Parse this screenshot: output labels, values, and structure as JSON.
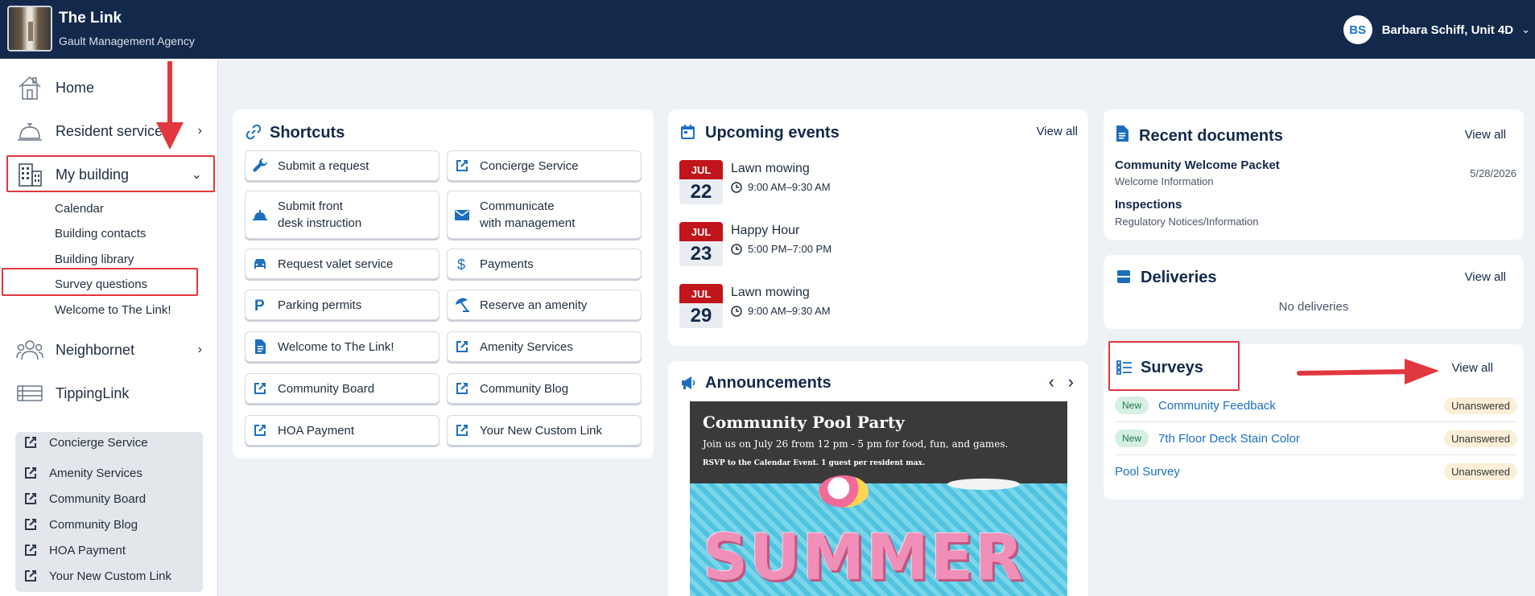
{
  "header": {
    "app_title": "The Link",
    "agency": "Gault Management Agency",
    "user_initials": "BS",
    "user_name": "Barbara Schiff, Unit 4D"
  },
  "sidebar": {
    "items": [
      {
        "label": "Home",
        "icon": "home-icon"
      },
      {
        "label": "Resident services",
        "icon": "concierge-bell-icon"
      },
      {
        "label": "My building",
        "icon": "building-icon"
      },
      {
        "label": "Neighbornet",
        "icon": "people-icon"
      },
      {
        "label": "TippingLink",
        "icon": "tipping-list-icon"
      }
    ],
    "subitems": [
      "Calendar",
      "Building contacts",
      "Building library",
      "Survey questions",
      "Welcome to The Link!"
    ],
    "quick_links": [
      "Concierge Service",
      "Amenity Services",
      "Community Board",
      "Community Blog",
      "HOA Payment",
      "Your New Custom Link"
    ]
  },
  "shortcuts": {
    "title": "Shortcuts",
    "left": [
      {
        "label": "Submit a request",
        "icon": "wrench-icon"
      },
      {
        "label": "Submit front\ndesk instruction",
        "icon": "concierge-bell-icon"
      },
      {
        "label": "Request valet service",
        "icon": "car-icon"
      },
      {
        "label": "Parking permits",
        "icon": "parking-icon"
      },
      {
        "label": "Welcome to The Link!",
        "icon": "document-icon"
      },
      {
        "label": "Community Board",
        "icon": "external-link-icon"
      },
      {
        "label": "HOA Payment",
        "icon": "external-link-icon"
      }
    ],
    "right": [
      {
        "label": "Concierge Service",
        "icon": "external-link-icon"
      },
      {
        "label": "Communicate\nwith management",
        "icon": "mail-icon"
      },
      {
        "label": "Payments",
        "icon": "dollar-icon"
      },
      {
        "label": "Reserve an amenity",
        "icon": "umbrella-icon"
      },
      {
        "label": "Amenity Services",
        "icon": "external-link-icon"
      },
      {
        "label": "Community Blog",
        "icon": "external-link-icon"
      },
      {
        "label": "Your New Custom Link",
        "icon": "external-link-icon"
      }
    ]
  },
  "events": {
    "title": "Upcoming events",
    "view_all": "View all",
    "items": [
      {
        "month": "JUL",
        "day": "22",
        "title": "Lawn mowing",
        "time": "9:00 AM–9:30 AM"
      },
      {
        "month": "JUL",
        "day": "23",
        "title": "Happy Hour",
        "time": "5:00 PM–7:00 PM"
      },
      {
        "month": "JUL",
        "day": "29",
        "title": "Lawn mowing",
        "time": "9:00 AM–9:30 AM"
      }
    ]
  },
  "announcements": {
    "title": "Announcements",
    "prev": "‹",
    "next": "›",
    "headline": "Community Pool Party",
    "line1": "Join us on July 26 from 12 pm - 5 pm for food, fun, and games.",
    "line2": "RSVP to the Calendar Event. 1 guest per resident max.",
    "image_word": "SUMMER"
  },
  "documents": {
    "title": "Recent documents",
    "view_all": "View all",
    "items": [
      {
        "title": "Community Welcome Packet",
        "category": "Welcome Information",
        "date": "5/28/2026"
      },
      {
        "title": "Inspections",
        "category": "Regulatory Notices/Information",
        "date": ""
      }
    ]
  },
  "deliveries": {
    "title": "Deliveries",
    "view_all": "View all",
    "empty": "No deliveries"
  },
  "surveys": {
    "title": "Surveys",
    "view_all": "View all",
    "items": [
      {
        "badge": "New",
        "title": "Community Feedback",
        "status": "Unanswered"
      },
      {
        "badge": "New",
        "title": "7th Floor Deck Stain Color",
        "status": "Unanswered"
      },
      {
        "badge": "",
        "title": "Pool Survey",
        "status": "Unanswered"
      }
    ]
  },
  "colors": {
    "navy": "#13294b",
    "accent_blue": "#1c6fbf",
    "annotation_red": "#e0383e",
    "event_red": "#c0151b"
  }
}
